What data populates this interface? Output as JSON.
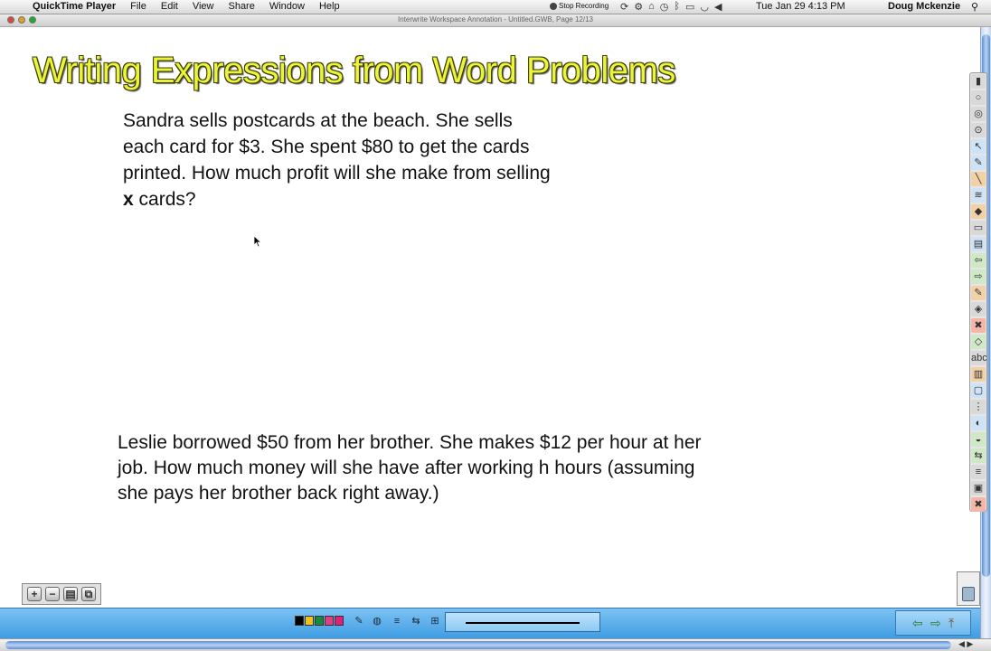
{
  "menubar": {
    "apple_glyph": "",
    "app_name": "QuickTime Player",
    "menus": [
      "File",
      "Edit",
      "View",
      "Share",
      "Window",
      "Help"
    ],
    "recording_label": "Stop Recording",
    "clock": "Tue Jan 29  4:13 PM",
    "user": "Doug Mckenzie",
    "spotlight_glyph": "⚲"
  },
  "window": {
    "title": "Interwrite Workspace Annotation - Untitled.GWB, Page 12/13"
  },
  "slide": {
    "title": "Writing Expressions from Word Problems",
    "problem1": {
      "lines": [
        "Sandra sells postcards at the beach.  She sells",
        "each card for $3.  She spent $80 to get the cards",
        "printed.  How much profit will she make from selling"
      ],
      "variable": "x",
      "tail": " cards?"
    },
    "problem2": {
      "lines": [
        "Leslie borrowed $50 from her brother.  She makes $12 per hour at her",
        "job.  How much money will she have after working h hours (assuming",
        "she pays her brother back right away.)"
      ]
    }
  },
  "colors": {
    "title_fill": "#eaf43a",
    "toolbar_blue": "#3f9de2",
    "swatches": [
      "#000000",
      "#f0c020",
      "#1a8a3a",
      "#e04080",
      "#e0207a"
    ]
  },
  "bottombar": {
    "page_buttons": [
      "+",
      "−",
      "▤",
      "⧉"
    ],
    "tools": [
      "✎",
      "◍",
      "≡",
      "⇆",
      "⊞"
    ],
    "nav": [
      "⇦",
      "⇨",
      "⤒"
    ]
  },
  "tools_palette": {
    "icons": [
      "▮",
      "○",
      "◎",
      "⊙",
      "↖",
      "✎",
      "╲",
      "≋",
      "◆",
      "▭",
      "▤",
      "⇦",
      "⇨",
      "✎",
      "◈",
      "✖",
      "◇",
      "abc",
      "▥",
      "▢",
      "⋮",
      "◐",
      "◒",
      "⇆",
      "≡",
      "▣",
      "✖"
    ]
  }
}
